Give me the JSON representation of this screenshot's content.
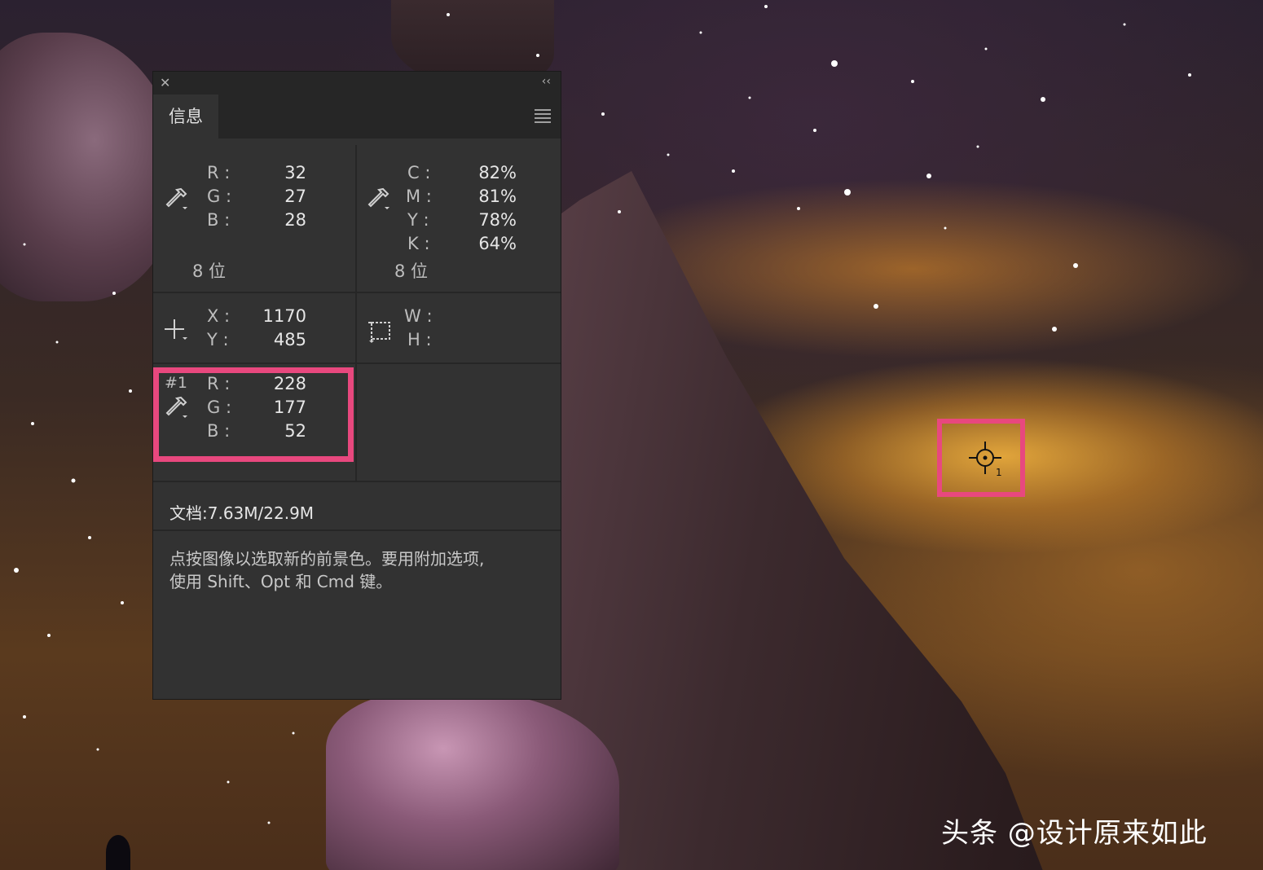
{
  "panel": {
    "close_glyph": "✕",
    "collapse_glyph": "‹‹",
    "tab_label": "信息",
    "rgb": {
      "r_label": "R :",
      "g_label": "G :",
      "b_label": "B :",
      "r": "32",
      "g": "27",
      "b": "28",
      "bits": "8 位"
    },
    "cmyk": {
      "c_label": "C :",
      "m_label": "M :",
      "y_label": "Y :",
      "k_label": "K :",
      "c": "82%",
      "m": "81%",
      "y": "78%",
      "k": "64%",
      "bits": "8 位"
    },
    "position": {
      "x_label": "X :",
      "y_label": "Y :",
      "x": "1170",
      "y": "485"
    },
    "size": {
      "w_label": "W :",
      "h_label": "H :"
    },
    "sampler": {
      "tag": "#1",
      "r_label": "R :",
      "g_label": "G :",
      "b_label": "B :",
      "r": "228",
      "g": "177",
      "b": "52"
    },
    "doc_info": "文档:7.63M/22.9M",
    "hint_line1": "点按图像以选取新的前景色。要用附加选项,",
    "hint_line2": "使用 Shift、Opt 和 Cmd 键。"
  },
  "canvas": {
    "cursor_index": "1",
    "watermark": "头条 @设计原来如此"
  },
  "colors": {
    "highlight": "#e8487e",
    "panel_bg": "#323232",
    "panel_header": "#262626"
  },
  "icons": [
    "eyedropper-icon",
    "crosshair-icon",
    "marquee-icon",
    "color-sampler-icon",
    "menu-icon",
    "close-icon",
    "collapse-icon"
  ]
}
